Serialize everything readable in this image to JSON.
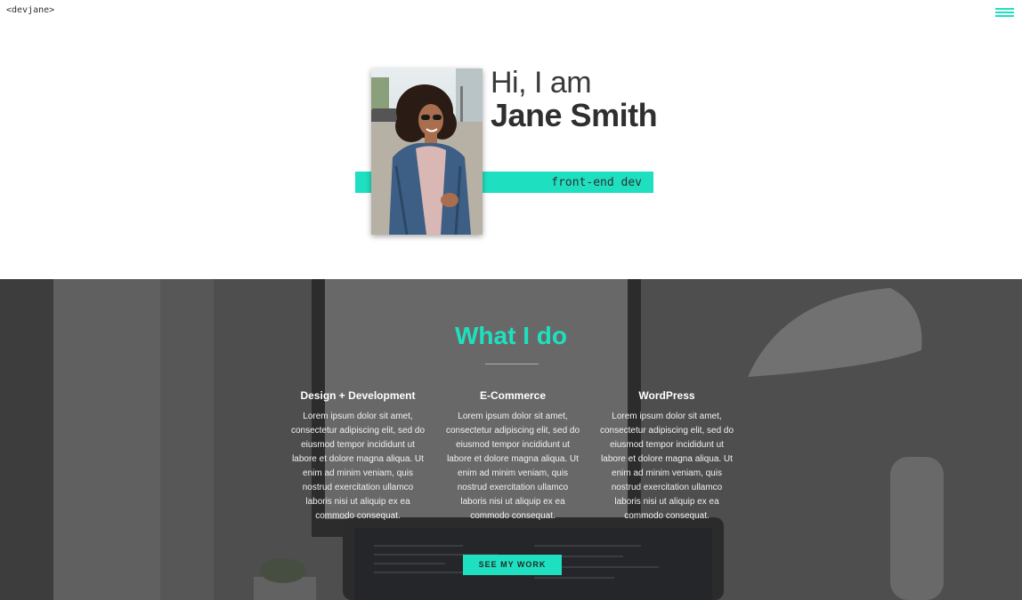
{
  "header": {
    "logo_text": "<devjane>",
    "menu_icon": "hamburger-icon"
  },
  "hero": {
    "greeting": "Hi, I am",
    "name": "Jane Smith",
    "role": "front-end dev",
    "accent_color": "#1ee0c0"
  },
  "services": {
    "title": "What I do",
    "items": [
      {
        "heading": "Design + Development",
        "body": "Lorem ipsum dolor sit amet, consectetur adipiscing elit, sed do eiusmod tempor incididunt ut labore et dolore magna aliqua. Ut enim ad minim veniam, quis nostrud exercitation ullamco laboris nisi ut aliquip ex ea commodo consequat."
      },
      {
        "heading": "E-Commerce",
        "body": "Lorem ipsum dolor sit amet, consectetur adipiscing elit, sed do eiusmod tempor incididunt ut labore et dolore magna aliqua. Ut enim ad minim veniam, quis nostrud exercitation ullamco laboris nisi ut aliquip ex ea commodo consequat."
      },
      {
        "heading": "WordPress",
        "body": "Lorem ipsum dolor sit amet, consectetur adipiscing elit, sed do eiusmod tempor incididunt ut labore et dolore magna aliqua. Ut enim ad minim veniam, quis nostrud exercitation ullamco laboris nisi ut aliquip ex ea commodo consequat."
      }
    ],
    "cta_label": "SEE MY WORK"
  }
}
